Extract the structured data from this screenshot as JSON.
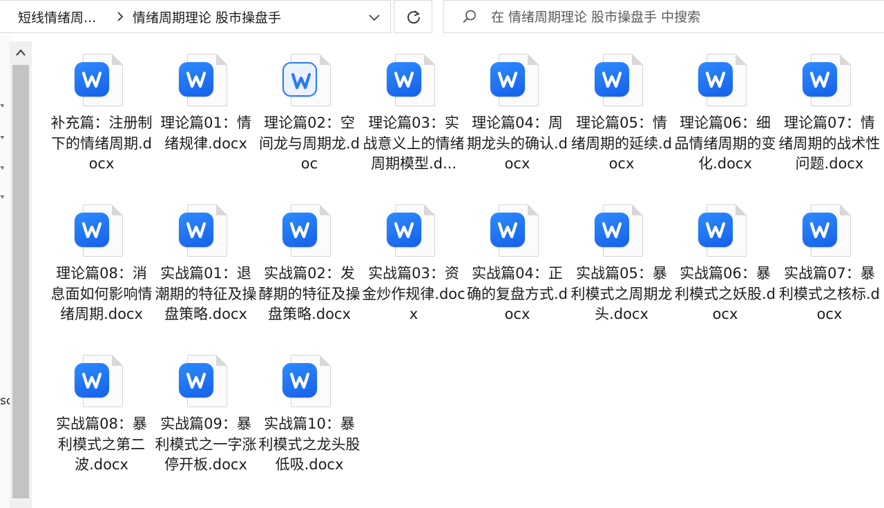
{
  "address_bar": {
    "crumb_parent": "短线情绪周...",
    "crumb_current": "情绪周期理论 股市操盘手"
  },
  "search": {
    "placeholder": "在 情绪周期理论 股市操盘手 中搜索",
    "value": ""
  },
  "left_cut_text": "sc",
  "files": [
    {
      "name": "补充篇：注册制下的情绪周期.docx"
    },
    {
      "name": "理论篇01：情绪规律.docx"
    },
    {
      "name": "理论篇02：空间龙与周期龙.doc"
    },
    {
      "name": "理论篇03：实战意义上的情绪周期模型.d..."
    },
    {
      "name": "理论篇04：周期龙头的确认.docx"
    },
    {
      "name": "理论篇05：情绪周期的延续.docx"
    },
    {
      "name": "理论篇06：细品情绪周期的变化.docx"
    },
    {
      "name": "理论篇07：情绪周期的战术性问题.docx"
    },
    {
      "name": "理论篇08：消息面如何影响情绪周期.docx"
    },
    {
      "name": "实战篇01：退潮期的特征及操盘策略.docx"
    },
    {
      "name": "实战篇02：发酵期的特征及操盘策略.docx"
    },
    {
      "name": "实战篇03：资金炒作规律.docx"
    },
    {
      "name": "实战篇04：正确的复盘方式.docx"
    },
    {
      "name": "实战篇05：暴利模式之周期龙头.docx"
    },
    {
      "name": "实战篇06：暴利模式之妖股.docx"
    },
    {
      "name": "实战篇07：暴利模式之核标.docx"
    },
    {
      "name": "实战篇08：暴利模式之第二波.docx"
    },
    {
      "name": "实战篇09：暴利模式之一字涨停开板.docx"
    },
    {
      "name": "实战篇10：暴利模式之龙头股低吸.docx"
    }
  ]
}
